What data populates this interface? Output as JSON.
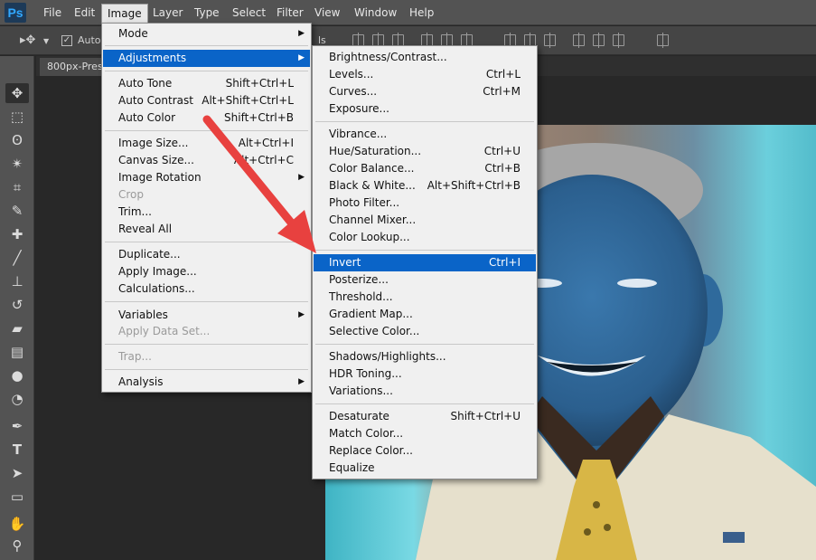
{
  "app": {
    "logo": "Ps"
  },
  "menubar": {
    "items": [
      "File",
      "Edit",
      "Image",
      "Layer",
      "Type",
      "Select",
      "Filter",
      "View",
      "Window",
      "Help"
    ]
  },
  "options": {
    "auto_select_label": "Auto-",
    "partial_text": "ls"
  },
  "document": {
    "tab_title": "800px-Presi"
  },
  "image_menu": {
    "items": [
      {
        "label": "Mode",
        "submenu": true
      },
      {
        "label": "Adjustments",
        "submenu": true,
        "highlighted": true
      },
      {
        "label": "Auto Tone",
        "shortcut": "Shift+Ctrl+L"
      },
      {
        "label": "Auto Contrast",
        "shortcut": "Alt+Shift+Ctrl+L"
      },
      {
        "label": "Auto Color",
        "shortcut": "Shift+Ctrl+B"
      },
      {
        "label": "Image Size...",
        "shortcut": "Alt+Ctrl+I"
      },
      {
        "label": "Canvas Size...",
        "shortcut": "Alt+Ctrl+C"
      },
      {
        "label": "Image Rotation",
        "submenu": true
      },
      {
        "label": "Crop",
        "disabled": true
      },
      {
        "label": "Trim..."
      },
      {
        "label": "Reveal All"
      },
      {
        "label": "Duplicate..."
      },
      {
        "label": "Apply Image..."
      },
      {
        "label": "Calculations..."
      },
      {
        "label": "Variables",
        "submenu": true
      },
      {
        "label": "Apply Data Set...",
        "disabled": true
      },
      {
        "label": "Trap...",
        "disabled": true
      },
      {
        "label": "Analysis",
        "submenu": true
      }
    ]
  },
  "adjustments_menu": {
    "items": [
      {
        "label": "Brightness/Contrast..."
      },
      {
        "label": "Levels...",
        "shortcut": "Ctrl+L"
      },
      {
        "label": "Curves...",
        "shortcut": "Ctrl+M"
      },
      {
        "label": "Exposure..."
      },
      {
        "label": "Vibrance..."
      },
      {
        "label": "Hue/Saturation...",
        "shortcut": "Ctrl+U"
      },
      {
        "label": "Color Balance...",
        "shortcut": "Ctrl+B"
      },
      {
        "label": "Black & White...",
        "shortcut": "Alt+Shift+Ctrl+B"
      },
      {
        "label": "Photo Filter..."
      },
      {
        "label": "Channel Mixer..."
      },
      {
        "label": "Color Lookup..."
      },
      {
        "label": "Invert",
        "shortcut": "Ctrl+I",
        "highlighted": true
      },
      {
        "label": "Posterize..."
      },
      {
        "label": "Threshold..."
      },
      {
        "label": "Gradient Map..."
      },
      {
        "label": "Selective Color..."
      },
      {
        "label": "Shadows/Highlights..."
      },
      {
        "label": "HDR Toning..."
      },
      {
        "label": "Variations..."
      },
      {
        "label": "Desaturate",
        "shortcut": "Shift+Ctrl+U"
      },
      {
        "label": "Match Color..."
      },
      {
        "label": "Replace Color..."
      },
      {
        "label": "Equalize"
      }
    ]
  },
  "colors": {
    "highlight": "#0a64c8",
    "arrow": "#e8413f"
  },
  "tools": [
    "move-tool",
    "marquee-tool",
    "lasso-tool",
    "magic-wand-tool",
    "crop-tool",
    "eyedropper-tool",
    "healing-brush-tool",
    "brush-tool",
    "clone-stamp-tool",
    "history-brush-tool",
    "eraser-tool",
    "gradient-tool",
    "blur-tool",
    "dodge-tool",
    "pen-tool",
    "type-tool",
    "path-selection-tool",
    "rectangle-tool",
    "hand-tool",
    "zoom-tool"
  ]
}
